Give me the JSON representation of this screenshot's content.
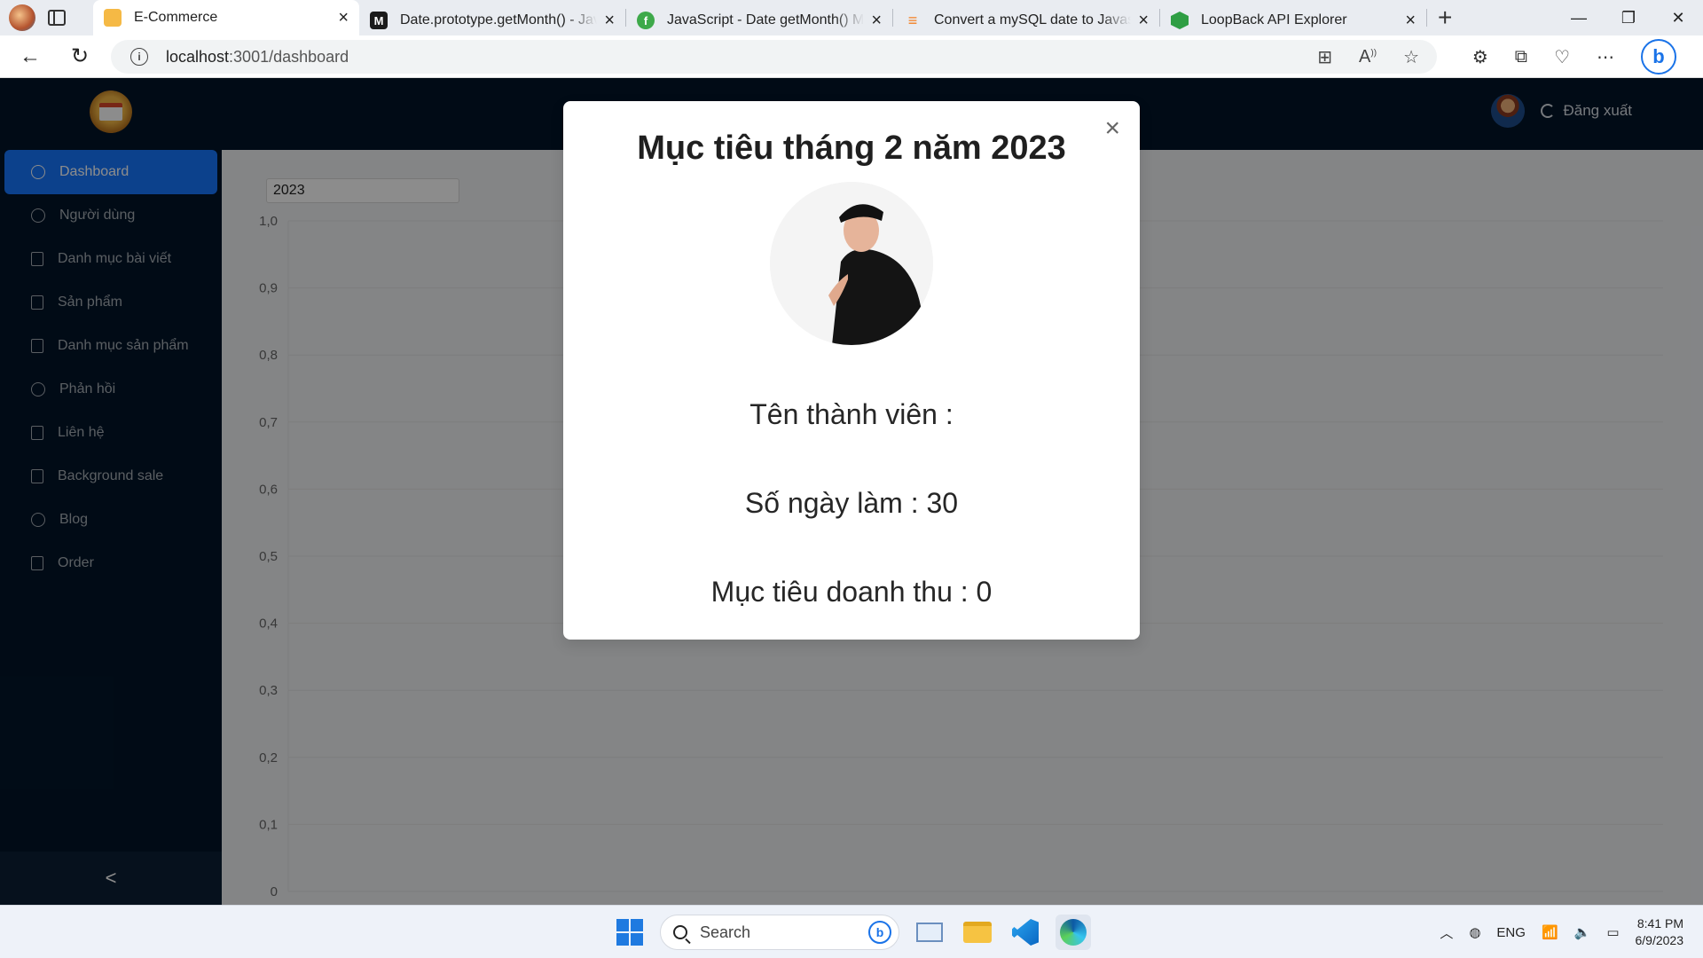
{
  "browser": {
    "tabs": [
      {
        "title": "E-Commerce",
        "active": true,
        "icon": "ecommerce-favicon"
      },
      {
        "title": "Date.prototype.getMonth() - JavaScript | MDN",
        "active": false,
        "icon": "mdn-favicon"
      },
      {
        "title": "JavaScript - Date getMonth() Method",
        "active": false,
        "icon": "tutorialspoint-favicon"
      },
      {
        "title": "Convert a mySQL date to Javascript date",
        "active": false,
        "icon": "stackoverflow-favicon"
      },
      {
        "title": "LoopBack API Explorer",
        "active": false,
        "icon": "loopback-favicon"
      }
    ],
    "url_host": "localhost",
    "url_path": ":3001/dashboard"
  },
  "app": {
    "logout_label": "Đăng xuất",
    "sidebar": {
      "items": [
        {
          "label": "Dashboard",
          "icon": "pie-chart-icon",
          "active": true
        },
        {
          "label": "Người dùng",
          "icon": "user-icon",
          "active": false
        },
        {
          "label": "Danh mục bài viết",
          "icon": "book-icon",
          "active": false
        },
        {
          "label": "Sản phẩm",
          "icon": "product-icon",
          "active": false
        },
        {
          "label": "Danh mục sản phẩm",
          "icon": "book-icon",
          "active": false
        },
        {
          "label": "Phản hồi",
          "icon": "message-icon",
          "active": false
        },
        {
          "label": "Liên hệ",
          "icon": "contacts-icon",
          "active": false
        },
        {
          "label": "Background sale",
          "icon": "file-icon",
          "active": false
        },
        {
          "label": "Blog",
          "icon": "paperclip-icon",
          "active": false
        },
        {
          "label": "Order",
          "icon": "order-icon",
          "active": false
        }
      ],
      "collapse_glyph": "<"
    },
    "year_value": "2023"
  },
  "chart_data": {
    "type": "line",
    "series": [],
    "y_ticks": [
      "1,0",
      "0,9",
      "0,8",
      "0,7",
      "0,6",
      "0,5",
      "0,4",
      "0,3",
      "0,2",
      "0,1",
      "0"
    ],
    "ylim": [
      0,
      1
    ],
    "grid": true
  },
  "modal": {
    "title": "Mục tiêu tháng 2 năm 2023",
    "member_line": "Tên thành viên :",
    "days_line": "Số ngày làm : 30",
    "revenue_line": "Mục tiêu doanh thu : 0",
    "close_glyph": "×"
  },
  "taskbar": {
    "search_placeholder": "Search",
    "language": "ENG",
    "time": "8:41 PM",
    "date": "6/9/2023"
  }
}
